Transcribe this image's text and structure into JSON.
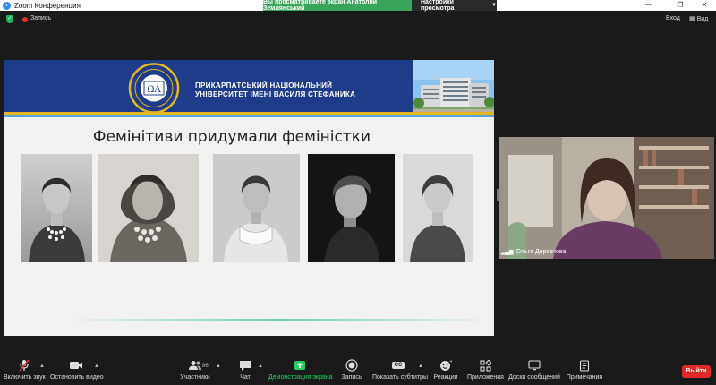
{
  "window": {
    "title": "Zoom Конференция"
  },
  "share_banner": "Вы просматриваете экран Анатолий Землянський",
  "view_options": "Настройки просмотра",
  "topbar": {
    "recording": "Запись",
    "login": "Вход",
    "view": "Вид"
  },
  "slide": {
    "university_line1": "ПРИКАРПАТСЬКИЙ НАЦІОНАЛЬНИЙ",
    "university_line2": "УНІВЕРСИТЕТ ІМЕНІ ВАСИЛЯ СТЕФАНИКА",
    "emblem_text": "ΩA",
    "title": "Фемінітиви придумали феміністки"
  },
  "participant": {
    "name": "Ольга Деркачова"
  },
  "toolbar": {
    "mute": "Включить звук",
    "video": "Остановить видео",
    "participants": "Участники",
    "participants_count": "86",
    "chat": "Чат",
    "share": "Демонстрация экрана",
    "record": "Запись",
    "captions": "Показать субтитры",
    "captions_icon": "CC",
    "reactions": "Реакции",
    "apps": "Приложения",
    "whiteboards": "Доски сообщений",
    "notes": "Примечания",
    "leave": "Выйти"
  },
  "colors": {
    "share_banner": "#3aa55a",
    "slide_header": "#1d3c8a",
    "accent_gold": "#e3b620",
    "leave": "#e02828",
    "share_active": "#23d160"
  }
}
